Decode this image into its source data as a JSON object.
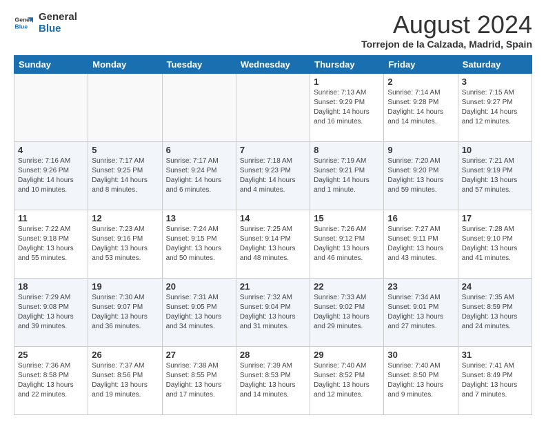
{
  "logo": {
    "line1": "General",
    "line2": "Blue"
  },
  "title": "August 2024",
  "subtitle": "Torrejon de la Calzada, Madrid, Spain",
  "days_header": [
    "Sunday",
    "Monday",
    "Tuesday",
    "Wednesday",
    "Thursday",
    "Friday",
    "Saturday"
  ],
  "weeks": [
    [
      {
        "day": "",
        "info": ""
      },
      {
        "day": "",
        "info": ""
      },
      {
        "day": "",
        "info": ""
      },
      {
        "day": "",
        "info": ""
      },
      {
        "day": "1",
        "info": "Sunrise: 7:13 AM\nSunset: 9:29 PM\nDaylight: 14 hours\nand 16 minutes."
      },
      {
        "day": "2",
        "info": "Sunrise: 7:14 AM\nSunset: 9:28 PM\nDaylight: 14 hours\nand 14 minutes."
      },
      {
        "day": "3",
        "info": "Sunrise: 7:15 AM\nSunset: 9:27 PM\nDaylight: 14 hours\nand 12 minutes."
      }
    ],
    [
      {
        "day": "4",
        "info": "Sunrise: 7:16 AM\nSunset: 9:26 PM\nDaylight: 14 hours\nand 10 minutes."
      },
      {
        "day": "5",
        "info": "Sunrise: 7:17 AM\nSunset: 9:25 PM\nDaylight: 14 hours\nand 8 minutes."
      },
      {
        "day": "6",
        "info": "Sunrise: 7:17 AM\nSunset: 9:24 PM\nDaylight: 14 hours\nand 6 minutes."
      },
      {
        "day": "7",
        "info": "Sunrise: 7:18 AM\nSunset: 9:23 PM\nDaylight: 14 hours\nand 4 minutes."
      },
      {
        "day": "8",
        "info": "Sunrise: 7:19 AM\nSunset: 9:21 PM\nDaylight: 14 hours\nand 1 minute."
      },
      {
        "day": "9",
        "info": "Sunrise: 7:20 AM\nSunset: 9:20 PM\nDaylight: 13 hours\nand 59 minutes."
      },
      {
        "day": "10",
        "info": "Sunrise: 7:21 AM\nSunset: 9:19 PM\nDaylight: 13 hours\nand 57 minutes."
      }
    ],
    [
      {
        "day": "11",
        "info": "Sunrise: 7:22 AM\nSunset: 9:18 PM\nDaylight: 13 hours\nand 55 minutes."
      },
      {
        "day": "12",
        "info": "Sunrise: 7:23 AM\nSunset: 9:16 PM\nDaylight: 13 hours\nand 53 minutes."
      },
      {
        "day": "13",
        "info": "Sunrise: 7:24 AM\nSunset: 9:15 PM\nDaylight: 13 hours\nand 50 minutes."
      },
      {
        "day": "14",
        "info": "Sunrise: 7:25 AM\nSunset: 9:14 PM\nDaylight: 13 hours\nand 48 minutes."
      },
      {
        "day": "15",
        "info": "Sunrise: 7:26 AM\nSunset: 9:12 PM\nDaylight: 13 hours\nand 46 minutes."
      },
      {
        "day": "16",
        "info": "Sunrise: 7:27 AM\nSunset: 9:11 PM\nDaylight: 13 hours\nand 43 minutes."
      },
      {
        "day": "17",
        "info": "Sunrise: 7:28 AM\nSunset: 9:10 PM\nDaylight: 13 hours\nand 41 minutes."
      }
    ],
    [
      {
        "day": "18",
        "info": "Sunrise: 7:29 AM\nSunset: 9:08 PM\nDaylight: 13 hours\nand 39 minutes."
      },
      {
        "day": "19",
        "info": "Sunrise: 7:30 AM\nSunset: 9:07 PM\nDaylight: 13 hours\nand 36 minutes."
      },
      {
        "day": "20",
        "info": "Sunrise: 7:31 AM\nSunset: 9:05 PM\nDaylight: 13 hours\nand 34 minutes."
      },
      {
        "day": "21",
        "info": "Sunrise: 7:32 AM\nSunset: 9:04 PM\nDaylight: 13 hours\nand 31 minutes."
      },
      {
        "day": "22",
        "info": "Sunrise: 7:33 AM\nSunset: 9:02 PM\nDaylight: 13 hours\nand 29 minutes."
      },
      {
        "day": "23",
        "info": "Sunrise: 7:34 AM\nSunset: 9:01 PM\nDaylight: 13 hours\nand 27 minutes."
      },
      {
        "day": "24",
        "info": "Sunrise: 7:35 AM\nSunset: 8:59 PM\nDaylight: 13 hours\nand 24 minutes."
      }
    ],
    [
      {
        "day": "25",
        "info": "Sunrise: 7:36 AM\nSunset: 8:58 PM\nDaylight: 13 hours\nand 22 minutes."
      },
      {
        "day": "26",
        "info": "Sunrise: 7:37 AM\nSunset: 8:56 PM\nDaylight: 13 hours\nand 19 minutes."
      },
      {
        "day": "27",
        "info": "Sunrise: 7:38 AM\nSunset: 8:55 PM\nDaylight: 13 hours\nand 17 minutes."
      },
      {
        "day": "28",
        "info": "Sunrise: 7:39 AM\nSunset: 8:53 PM\nDaylight: 13 hours\nand 14 minutes."
      },
      {
        "day": "29",
        "info": "Sunrise: 7:40 AM\nSunset: 8:52 PM\nDaylight: 13 hours\nand 12 minutes."
      },
      {
        "day": "30",
        "info": "Sunrise: 7:40 AM\nSunset: 8:50 PM\nDaylight: 13 hours\nand 9 minutes."
      },
      {
        "day": "31",
        "info": "Sunrise: 7:41 AM\nSunset: 8:49 PM\nDaylight: 13 hours\nand 7 minutes."
      }
    ]
  ]
}
